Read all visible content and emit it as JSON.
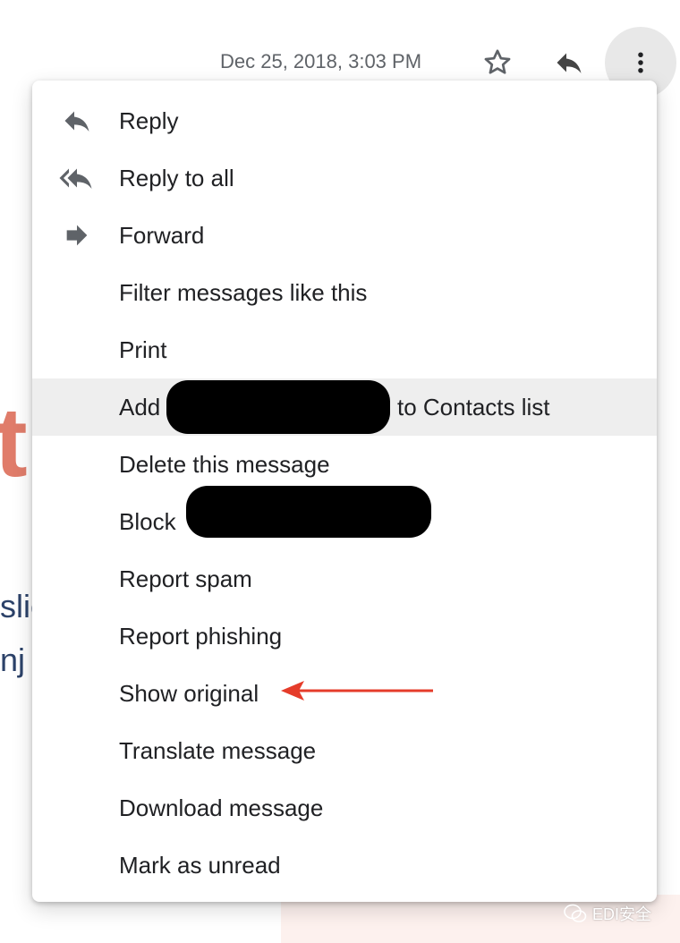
{
  "background": {
    "fragment_letter": "t",
    "fragment_line1": "slic",
    "fragment_line2": "nj"
  },
  "header": {
    "date": "Dec 25, 2018, 3:03 PM",
    "icons": [
      "star-icon",
      "reply-icon",
      "more-vert-icon"
    ]
  },
  "menu": {
    "items": [
      {
        "label": "Reply",
        "icon": "reply-icon"
      },
      {
        "label": "Reply to all",
        "icon": "reply-all-icon"
      },
      {
        "label": "Forward",
        "icon": "forward-icon"
      },
      {
        "label": "Filter messages like this"
      },
      {
        "label": "Print"
      },
      {
        "label": "Add",
        "label_after": "to Contacts list",
        "highlighted": true
      },
      {
        "label": "Delete this message"
      },
      {
        "label": "Block"
      },
      {
        "label": "Report spam"
      },
      {
        "label": "Report phishing"
      },
      {
        "label": "Show original",
        "annotated": true
      },
      {
        "label": "Translate message"
      },
      {
        "label": "Download message"
      },
      {
        "label": "Mark as unread"
      }
    ]
  },
  "colors": {
    "accent_arrow": "#e53c2a",
    "highlight": "#eeeeee",
    "icon_gray": "#5f6368"
  },
  "watermark": "EDI安全"
}
